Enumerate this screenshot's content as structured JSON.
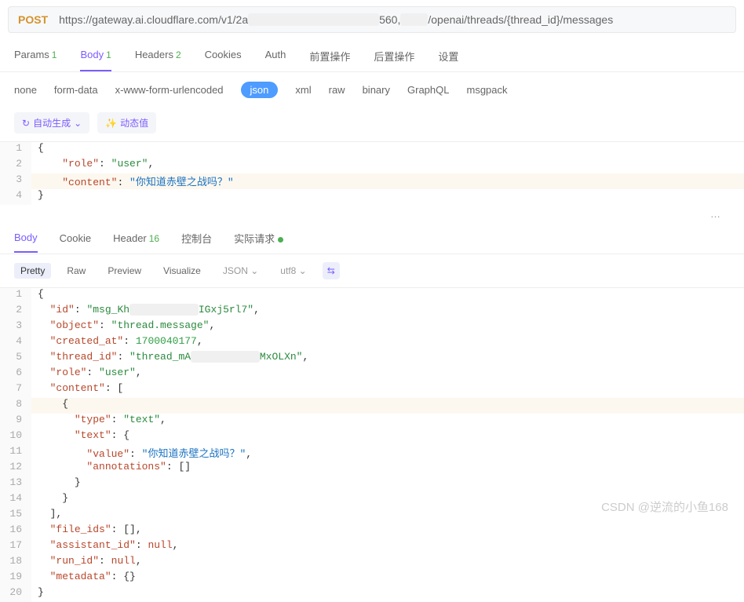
{
  "request": {
    "method": "POST",
    "url_prefix": "https://gateway.ai.cloudflare.com/v1/2a",
    "url_mid": "560,",
    "url_suffix": "/openai/threads/{thread_id}/messages"
  },
  "req_tabs": {
    "params": "Params",
    "params_badge": "1",
    "body": "Body",
    "body_badge": "1",
    "headers": "Headers",
    "headers_badge": "2",
    "cookies": "Cookies",
    "auth": "Auth",
    "pre": "前置操作",
    "post": "后置操作",
    "settings": "设置"
  },
  "body_types": {
    "none": "none",
    "form": "form-data",
    "xform": "x-www-form-urlencoded",
    "json": "json",
    "xml": "xml",
    "raw": "raw",
    "binary": "binary",
    "graphql": "GraphQL",
    "msgpack": "msgpack"
  },
  "toolbar": {
    "autogen": "自动生成",
    "dynamic": "动态值"
  },
  "req_body": {
    "l1": "{",
    "l2_k": "\"role\"",
    "l2_v": "\"user\"",
    "l3_k": "\"content\"",
    "l3_v": "\"你知道赤壁之战吗？\"",
    "l4": "}"
  },
  "resp_tabs": {
    "body": "Body",
    "cookie": "Cookie",
    "header": "Header",
    "header_badge": "16",
    "console": "控制台",
    "actual": "实际请求"
  },
  "view_modes": {
    "pretty": "Pretty",
    "raw": "Raw",
    "preview": "Preview",
    "visualize": "Visualize",
    "json": "JSON",
    "utf8": "utf8"
  },
  "resp_body": {
    "id_k": "\"id\"",
    "id_v1": "\"msg_Kh",
    "id_v2": "IGxj5rl7\"",
    "obj_k": "\"object\"",
    "obj_v": "\"thread.message\"",
    "created_k": "\"created_at\"",
    "created_v": "1700040177",
    "thread_k": "\"thread_id\"",
    "thread_v1": "\"thread_mA",
    "thread_v2": "MxOLXn\"",
    "role_k": "\"role\"",
    "role_v": "\"user\"",
    "content_k": "\"content\"",
    "type_k": "\"type\"",
    "type_v": "\"text\"",
    "text_k": "\"text\"",
    "value_k": "\"value\"",
    "value_v": "\"你知道赤壁之战吗？\"",
    "anno_k": "\"annotations\"",
    "fileids_k": "\"file_ids\"",
    "assist_k": "\"assistant_id\"",
    "null_v": "null",
    "runid_k": "\"run_id\"",
    "meta_k": "\"metadata\""
  },
  "watermark": "CSDN @逆流的小鱼168"
}
